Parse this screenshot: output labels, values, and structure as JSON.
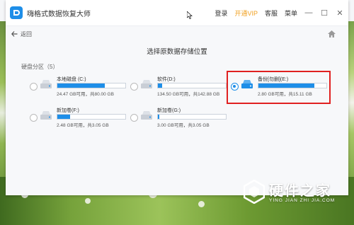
{
  "app": {
    "title": "嗨格式数据恢复大师"
  },
  "topbar": {
    "login": "登录",
    "vip": "开通VIP",
    "service": "客服",
    "menu": "菜单",
    "win_min": "—",
    "win_max": "☐",
    "win_close": "✕"
  },
  "nav": {
    "back_label": "返回"
  },
  "page_title": "选择原数据存储位置",
  "section": {
    "label": "硬盘分区（5）"
  },
  "colors": {
    "accent": "#1e8ee8",
    "vip": "#f0a020",
    "highlight_border": "#e02020"
  },
  "drives": [
    {
      "name": "本地磁盘 (C:)",
      "size": "24.47 GB可用，共80.00 GB",
      "used_pct": 70,
      "selected": false,
      "icon": "hard-drive-icon"
    },
    {
      "name": "软件(D:)",
      "size": "134.50 GB可用，共142.88 GB",
      "used_pct": 6,
      "selected": false,
      "icon": "hard-drive-icon"
    },
    {
      "name": "备份[勿删](E:)",
      "size": "2.80 GB可用，共15.11 GB",
      "used_pct": 82,
      "selected": true,
      "icon": "hard-drive-icon"
    },
    {
      "name": "新加卷(F:)",
      "size": "2.48 GB可用，共3.05 GB",
      "used_pct": 19,
      "selected": false,
      "icon": "hard-drive-icon"
    },
    {
      "name": "新加卷(G:)",
      "size": "3.00 GB可用，共3.05 GB",
      "used_pct": 2,
      "selected": false,
      "icon": "hard-drive-icon"
    }
  ],
  "watermark": {
    "cn": "硬件之家",
    "en": "YING JIAN ZHI JIA.COM"
  }
}
